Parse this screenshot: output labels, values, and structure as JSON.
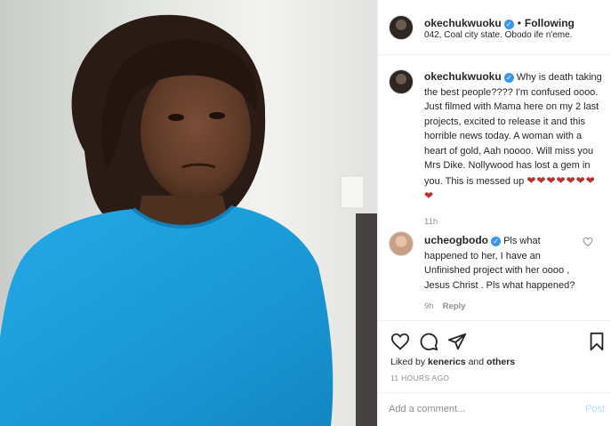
{
  "post": {
    "username": "okechukwuoku",
    "follow_status": "Following",
    "location": "042, Coal city state. Obodo ife n'eme.",
    "caption": "Why is death taking the best people???? I'm confused oooo. Just filmed with Mama here on my 2 last projects, excited to release it and this horrible news today. A woman with a heart of gold, Aah noooo. Will miss you Mrs Dike. Nollywood has lost a gem in you. This is messed up",
    "caption_hearts": "❤︎❤︎❤︎❤︎❤︎❤︎❤︎❤︎",
    "caption_time": "11h",
    "dot": "•"
  },
  "comments": [
    {
      "username": "ucheogbodo",
      "text": "Pls what happened to her, I have an Unfinished project with her oooo , Jesus Christ . Pls what happened?",
      "time": "9h",
      "reply_label": "Reply"
    }
  ],
  "engagement": {
    "liked_prefix": "Liked by",
    "liked_user": "kenerics",
    "liked_join": "and",
    "liked_others": "others",
    "time_ago": "11 HOURS AGO"
  },
  "add_comment": {
    "placeholder": "Add a comment...",
    "post_label": "Post"
  },
  "icons": [
    "heart-icon",
    "comment-icon",
    "share-icon",
    "bookmark-icon",
    "verified-icon",
    "small-heart-icon"
  ],
  "colors": {
    "verified": "#3897f0",
    "post_button_disabled": "#b2dffc",
    "muted": "#8e8e8e",
    "shirt": "#1ea0e0"
  }
}
